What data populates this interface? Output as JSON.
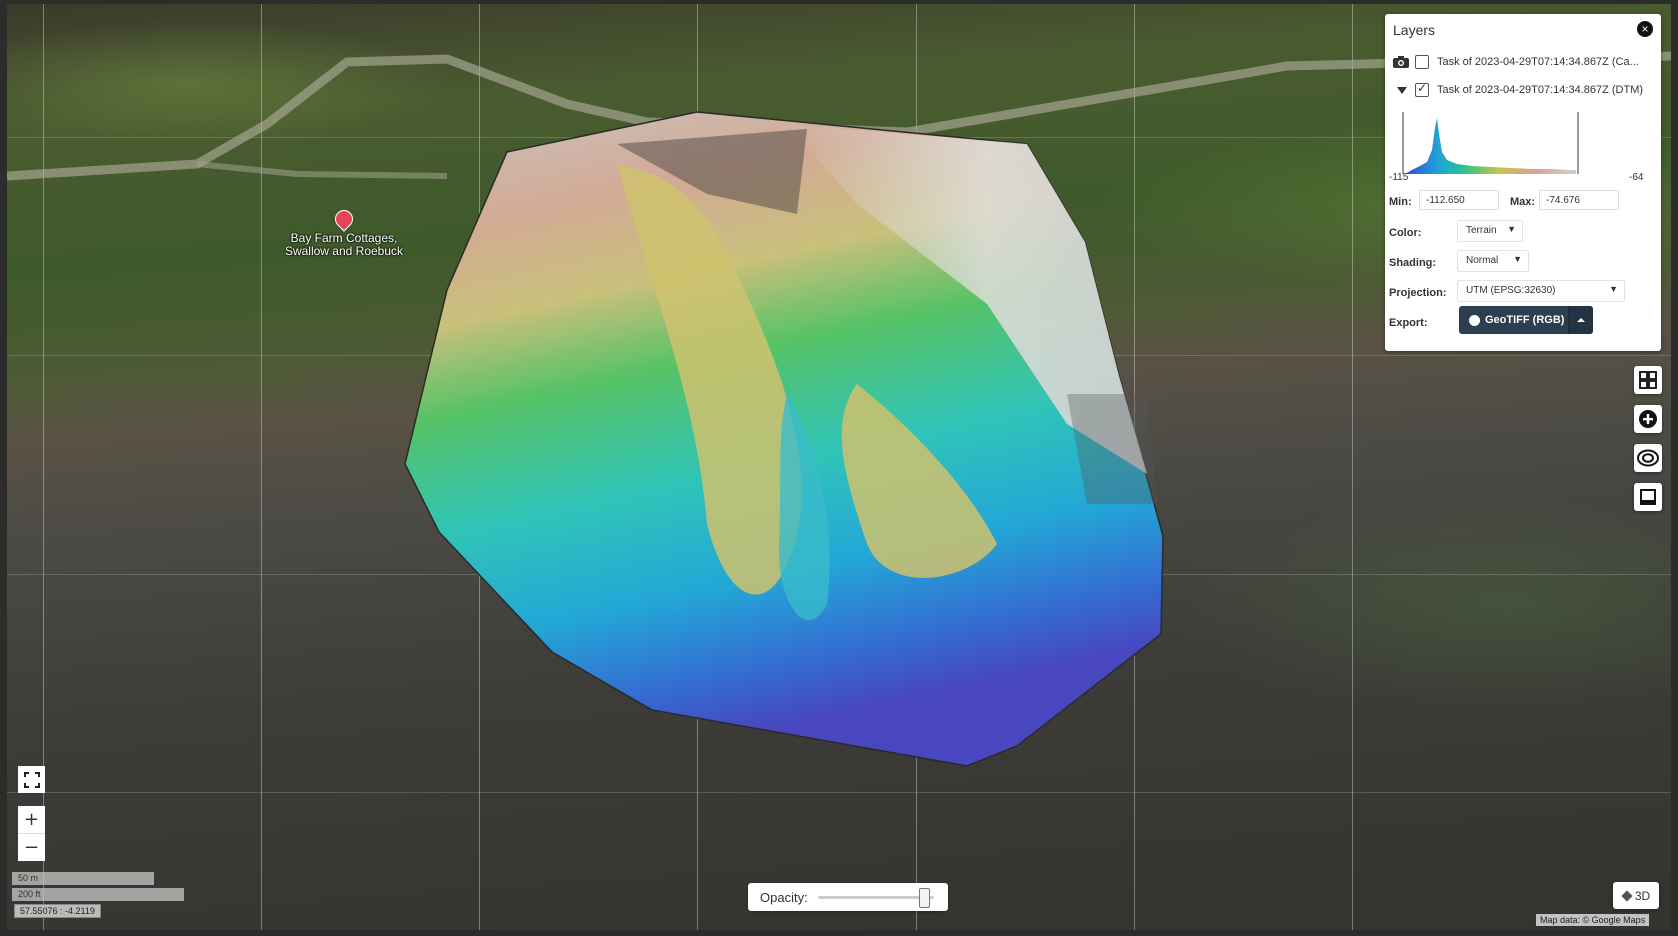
{
  "map": {
    "poi": {
      "label_line1": "Bay Farm Cottages,",
      "label_line2": "Swallow and Roebuck"
    },
    "coords": "57.55076 : -4.2119",
    "scale_metric": "50 m",
    "scale_imperial": "200 ft",
    "attribution": "Map data: © Google Maps"
  },
  "layers_panel": {
    "title": "Layers",
    "close_icon": "×",
    "layer1": {
      "label": "Task of 2023-04-29T07:14:34.867Z (Ca...",
      "checked": false
    },
    "layer2": {
      "label": "Task of 2023-04-29T07:14:34.867Z (DTM)",
      "checked": true
    },
    "hist_min_label": "-115",
    "hist_max_label": "-64",
    "min_label": "Min:",
    "min_value": "-112.650",
    "max_label": "Max:",
    "max_value": "-74.676",
    "color_label": "Color:",
    "color_value": "Terrain",
    "shading_label": "Shading:",
    "shading_value": "Normal",
    "projection_label": "Projection:",
    "projection_value": "UTM (EPSG:32630)",
    "export_label": "Export:",
    "export_button": "GeoTIFF (RGB)"
  },
  "opacity": {
    "label": "Opacity:",
    "value": 0.95
  },
  "view_3d": "3D",
  "zoom_in": "+",
  "zoom_out": "−",
  "dropdown_arrow": "▼"
}
